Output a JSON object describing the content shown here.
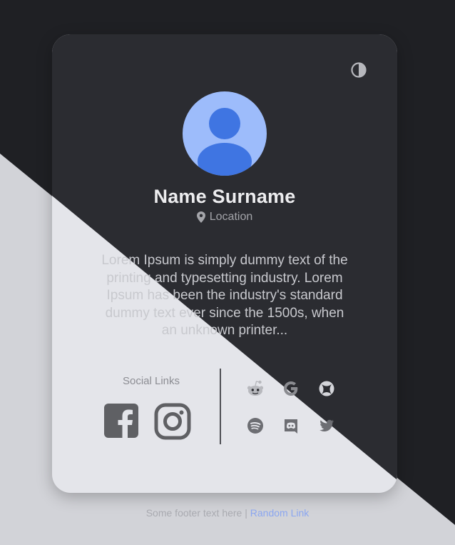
{
  "profile": {
    "name": "Name Surname",
    "location": "Location",
    "bio": "Lorem Ipsum is simply dummy text of the printing and typesetting industry. Lorem Ipsum has been the industry's standard dummy text ever since the 1500s, when an unknown printer..."
  },
  "social": {
    "title": "Social Links",
    "primary": [
      "facebook-icon",
      "instagram-icon"
    ],
    "secondary": [
      "reddit-icon",
      "google-icon",
      "xbox-icon",
      "spotify-icon",
      "discord-icon",
      "twitter-icon"
    ]
  },
  "footer": {
    "text": "Some footer text here |",
    "link_label": "Random Link"
  },
  "colors": {
    "background_dark": "#1f2024",
    "background_light": "#d2d3d8",
    "card_dark": "#2b2c31",
    "card_light": "#e4e5ea",
    "avatar_bg": "#9dbcfb",
    "avatar_fg": "#3f75e2",
    "link": "#8ba6f0"
  },
  "icons": {
    "theme_toggle": "contrast-icon",
    "location": "map-pin-icon",
    "avatar": "user-avatar-icon"
  }
}
